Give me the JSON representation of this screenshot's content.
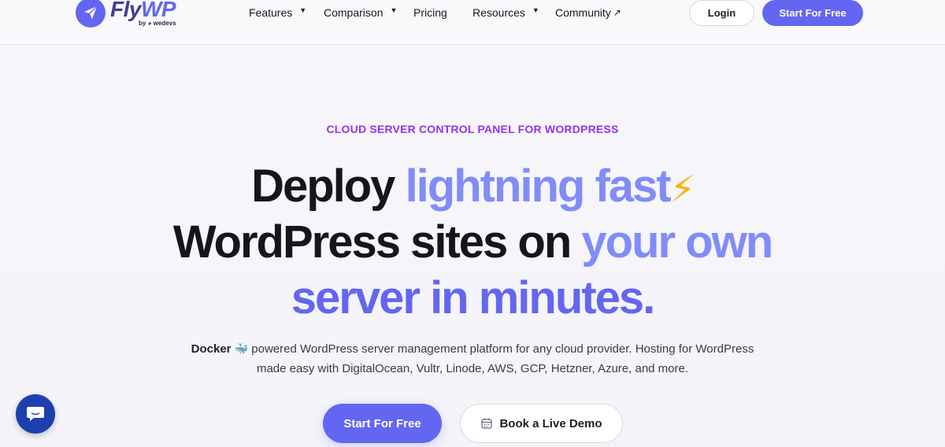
{
  "header": {
    "logo": {
      "word_a": "Fly",
      "word_b": "WP",
      "byline": "by ◕ wedevs"
    },
    "nav": [
      {
        "label": "Features",
        "has_dropdown": true
      },
      {
        "label": "Comparison",
        "has_dropdown": true
      },
      {
        "label": "Pricing",
        "has_dropdown": false
      },
      {
        "label": "Resources",
        "has_dropdown": true
      },
      {
        "label": "Community",
        "external": true,
        "icon": "external-arrow-icon"
      }
    ],
    "login_label": "Login",
    "start_label": "Start For Free"
  },
  "hero": {
    "eyebrow": "CLOUD SERVER CONTROL PANEL FOR WORDPRESS",
    "line1_a": "Deploy ",
    "line1_b": "lightning fast",
    "bolt": "⚡",
    "line2_a": "WordPress sites on ",
    "line2_b": "your own",
    "line3": "server in minutes.",
    "sub_strong": "Docker",
    "sub_whale": "🐳",
    "sub_1_rest": " powered WordPress server management platform for any cloud provider. Hosting for WordPress",
    "sub_2": "made easy with DigitalOcean, Vultr, Linode, AWS, GCP, Hetzner, Azure, and more.",
    "cta_primary": "Start For Free",
    "cta_secondary": "Book a Live Demo"
  },
  "colors": {
    "brand": "#6366f1",
    "light_accent": "#818cf8",
    "eyebrow": "#9333ea",
    "chat": "#1e40af"
  }
}
